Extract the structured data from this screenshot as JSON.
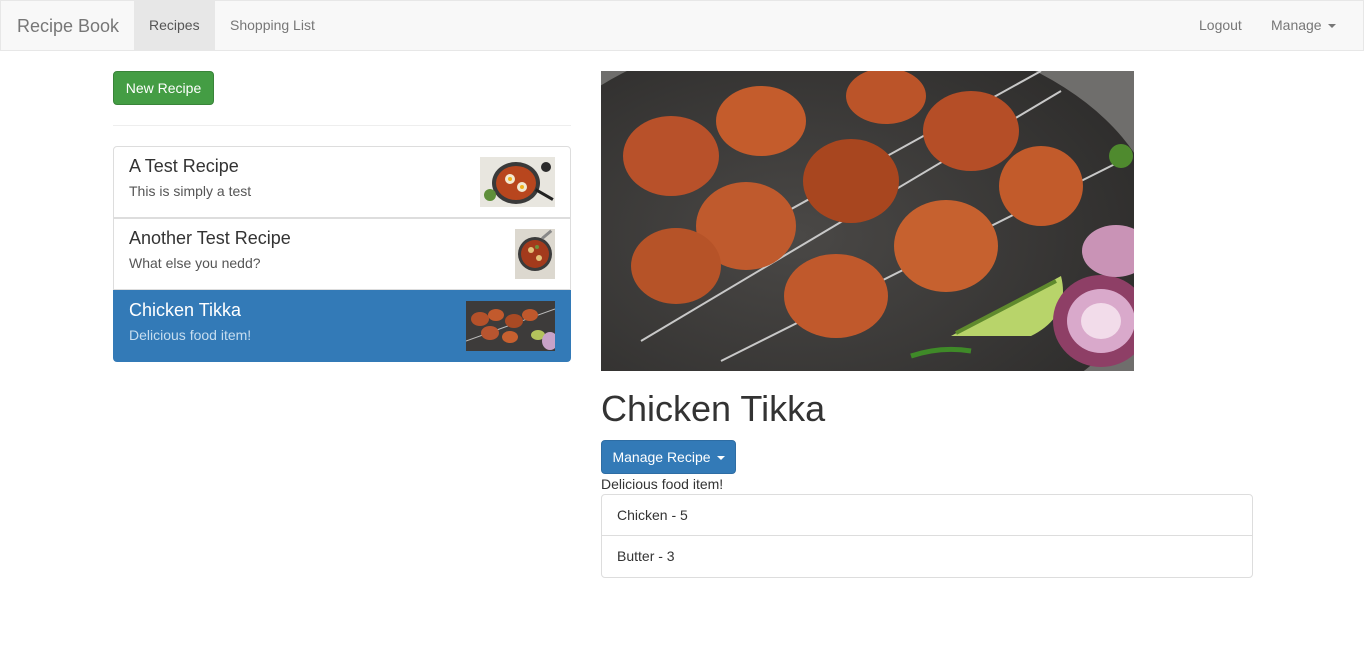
{
  "navbar": {
    "brand": "Recipe Book",
    "links": [
      "Recipes",
      "Shopping List"
    ],
    "logout": "Logout",
    "manage": "Manage"
  },
  "sidebar": {
    "new_button": "New Recipe",
    "recipes": [
      {
        "name": "A Test Recipe",
        "description": "This is simply a test",
        "active": false
      },
      {
        "name": "Another Test Recipe",
        "description": "What else you nedd?",
        "active": false
      },
      {
        "name": "Chicken Tikka",
        "description": "Delicious food item!",
        "active": true
      }
    ]
  },
  "detail": {
    "name": "Chicken Tikka",
    "manage_button": "Manage Recipe",
    "description": "Delicious food item!",
    "ingredients": [
      "Chicken - 5",
      "Butter - 3"
    ]
  },
  "colors": {
    "success": "#449d44",
    "primary": "#337ab7"
  }
}
